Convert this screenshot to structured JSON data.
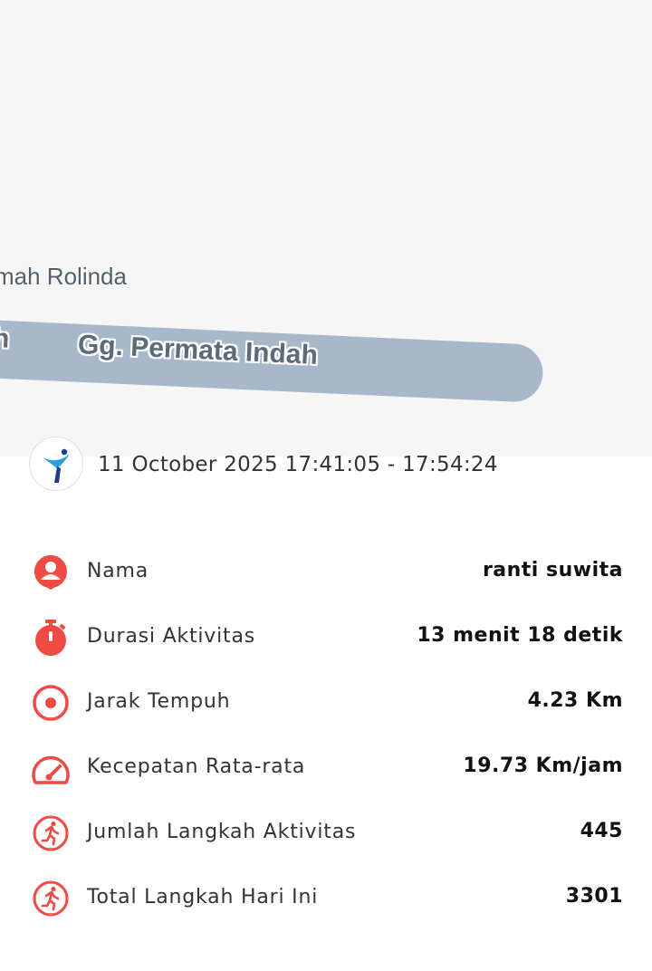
{
  "map": {
    "place_label": "mah Rolinda",
    "road_label": "Gg. Permata Indah",
    "road_label_cut": "h"
  },
  "header": {
    "datetime": "11 October 2025 17:41:05 - 17:54:24"
  },
  "stats": [
    {
      "icon": "person-pin-icon",
      "label": "Nama",
      "value": "ranti suwita"
    },
    {
      "icon": "stopwatch-icon",
      "label": "Durasi Aktivitas",
      "value": "13 menit 18 detik"
    },
    {
      "icon": "target-icon",
      "label": "Jarak Tempuh",
      "value": "4.23 Km"
    },
    {
      "icon": "speedometer-icon",
      "label": "Kecepatan Rata-rata",
      "value": "19.73 Km/jam"
    },
    {
      "icon": "running-icon",
      "label": "Jumlah Langkah Aktivitas",
      "value": "445"
    },
    {
      "icon": "running-icon",
      "label": "Total Langkah Hari Ini",
      "value": "3301"
    }
  ],
  "colors": {
    "accent": "#ef4b45",
    "map_background": "#f6f6f6",
    "road": "#a7b8cb"
  }
}
